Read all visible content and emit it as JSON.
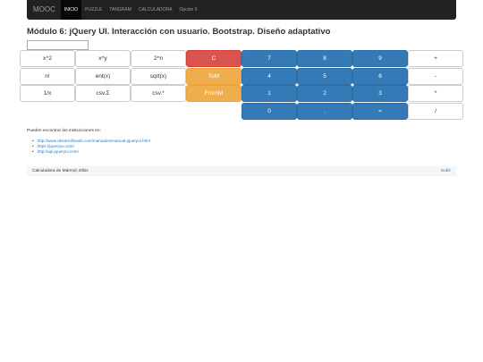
{
  "navbar": {
    "brand": "MOOC",
    "items": [
      {
        "label": "INICIO",
        "active": true
      },
      {
        "label": "PUZZLE",
        "active": false
      },
      {
        "label": "TANGRAM",
        "active": false
      },
      {
        "label": "CALCULADORA",
        "active": false
      },
      {
        "label": "Opción 5",
        "active": false
      }
    ]
  },
  "page_title": "Módulo 6: jQuery UI. Interacción con usuario. Bootstrap. Diseño adaptativo",
  "display": {
    "value": ""
  },
  "calculator": {
    "keys": [
      {
        "label": "x^2",
        "style": "def",
        "row": 0,
        "col": 0
      },
      {
        "label": "x^y",
        "style": "def",
        "row": 0,
        "col": 1
      },
      {
        "label": "2^n",
        "style": "def",
        "row": 0,
        "col": 2
      },
      {
        "label": "C",
        "style": "dan",
        "row": 0,
        "col": 3
      },
      {
        "label": "7",
        "style": "pri",
        "row": 0,
        "col": 4
      },
      {
        "label": "8",
        "style": "pri",
        "row": 0,
        "col": 5
      },
      {
        "label": "9",
        "style": "pri",
        "row": 0,
        "col": 6
      },
      {
        "label": "+",
        "style": "def",
        "row": 0,
        "col": 7
      },
      {
        "label": "n!",
        "style": "def",
        "row": 1,
        "col": 0
      },
      {
        "label": "ent(x)",
        "style": "def",
        "row": 1,
        "col": 1
      },
      {
        "label": "sqrt(x)",
        "style": "def",
        "row": 1,
        "col": 2
      },
      {
        "label": "ToM",
        "style": "war",
        "row": 1,
        "col": 3
      },
      {
        "label": "4",
        "style": "pri",
        "row": 1,
        "col": 4
      },
      {
        "label": "5",
        "style": "pri",
        "row": 1,
        "col": 5
      },
      {
        "label": "6",
        "style": "pri",
        "row": 1,
        "col": 6
      },
      {
        "label": "-",
        "style": "def",
        "row": 1,
        "col": 7
      },
      {
        "label": "1/x",
        "style": "def",
        "row": 2,
        "col": 0
      },
      {
        "label": "csv.Σ",
        "style": "def",
        "row": 2,
        "col": 1
      },
      {
        "label": "csv.*",
        "style": "def",
        "row": 2,
        "col": 2
      },
      {
        "label": "FromM",
        "style": "war",
        "row": 2,
        "col": 3
      },
      {
        "label": "1",
        "style": "pri",
        "row": 2,
        "col": 4
      },
      {
        "label": "2",
        "style": "pri",
        "row": 2,
        "col": 5
      },
      {
        "label": "3",
        "style": "pri",
        "row": 2,
        "col": 6
      },
      {
        "label": "*",
        "style": "def",
        "row": 2,
        "col": 7
      },
      {
        "label": "0",
        "style": "pri",
        "row": 3,
        "col": 4
      },
      {
        "label": ".",
        "style": "pri",
        "row": 3,
        "col": 5
      },
      {
        "label": "=",
        "style": "pri",
        "row": 3,
        "col": 6
      },
      {
        "label": "/",
        "style": "def",
        "row": 3,
        "col": 7
      }
    ]
  },
  "instructions": {
    "intro": "Pueden encontrar las instrucciones en:",
    "links": [
      "http://www.desarrolloweb.com/manuales/manual-jqueryui.html",
      "https://jqueryui.com/",
      "http://api.jqueryui.com/"
    ]
  },
  "footer": {
    "credit": "Calculadora de Mármol, Elbis",
    "back_to_top": "Subir"
  },
  "colors": {
    "navbar": "#222222",
    "primary": "#337ab7",
    "danger": "#d9534f",
    "warning": "#f0ad4e",
    "link": "#337ab7"
  }
}
